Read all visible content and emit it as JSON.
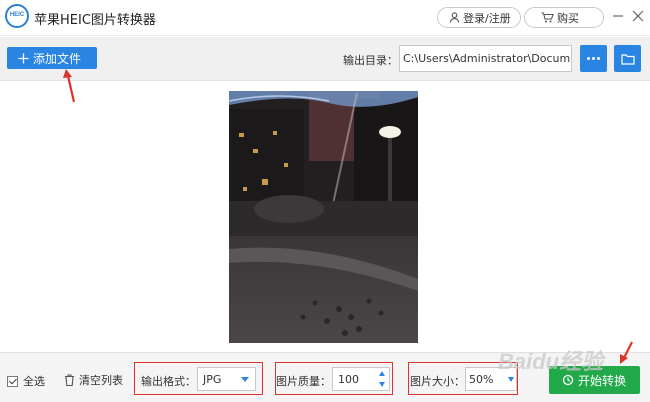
{
  "app": {
    "logo_text": "HEIC",
    "title": "苹果HEIC图片转换器",
    "login_label": "登录/注册",
    "buy_label": "购买"
  },
  "toolbar": {
    "add_file_label": "添加文件",
    "output_dir_label": "输出目录：",
    "output_dir_value": "C:\\Users\\Administrator\\Documents"
  },
  "bottom": {
    "select_all_label": "全选",
    "select_all_checked": true,
    "clear_list_label": "清空列表",
    "format_label": "输出格式：",
    "format_value": "JPG",
    "quality_label": "图片质量：",
    "quality_value": "100",
    "size_label": "图片大小：",
    "size_value": "50%",
    "start_label": "开始转换"
  },
  "watermark": "Baidu经验",
  "colors": {
    "accent_blue": "#2a84e2",
    "start_green": "#22a94a",
    "highlight_red": "#d9352c"
  },
  "icons": [
    "heic-logo-icon",
    "user-icon",
    "cart-icon",
    "minimize-icon",
    "close-icon",
    "plus-icon",
    "more-icon",
    "folder-icon",
    "trash-icon",
    "refresh-icon"
  ]
}
